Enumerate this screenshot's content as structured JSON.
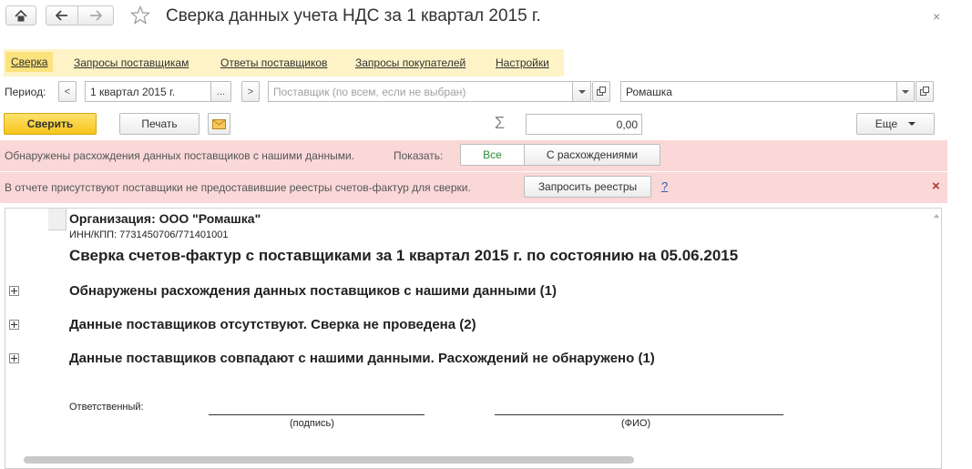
{
  "window": {
    "title": "Сверка данных учета НДС за 1 квартал 2015 г.",
    "close_glyph": "×"
  },
  "nav": {
    "home_icon": "home-icon",
    "back_icon": "arrow-left-icon",
    "forward_icon": "arrow-right-icon",
    "favorite_icon": "star-icon"
  },
  "tabs": [
    {
      "label": "Сверка",
      "active": true
    },
    {
      "label": "Запросы поставщикам"
    },
    {
      "label": "Ответы поставщиков"
    },
    {
      "label": "Запросы покупателей"
    },
    {
      "label": "Настройки"
    }
  ],
  "filters": {
    "period_label": "Период:",
    "period_value": "1 квартал 2015 г.",
    "prev_glyph": "<",
    "next_glyph": ">",
    "dots_glyph": "...",
    "supplier_placeholder": "Поставщик (по всем, если не выбран)",
    "organization_value": "Ромашка"
  },
  "toolbar": {
    "reconcile_label": "Сверить",
    "print_label": "Печать",
    "email_icon": "envelope-icon",
    "sum_glyph": "Σ",
    "sum_value": "0,00",
    "more_label": "Еще"
  },
  "discrepancy_bar": {
    "message": "Обнаружены расхождения данных поставщиков с нашими данными.",
    "show_label": "Показать:",
    "all_label": "Все",
    "with_diff_label": "С расхождениями"
  },
  "missing_bar": {
    "message": "В отчете присутствуют поставщики не предоставившие реестры счетов-фактур для сверки.",
    "request_label": "Запросить реестры",
    "help_glyph": "?",
    "close_glyph": "×"
  },
  "report": {
    "org_line": "Организация: ООО \"Ромашка\"",
    "inn_line": "ИНН/КПП: 7731450706/771401001",
    "heading": "Сверка счетов-фактур с поставщиками за 1 квартал 2015 г. по состоянию на 05.06.2015",
    "groups": [
      "Обнаружены расхождения данных поставщиков с нашими данными (1)",
      "Данные поставщиков отсутствуют. Сверка не проведена (2)",
      "Данные поставщиков совпадают с нашими данными. Расхождений не обнаружено (1)"
    ],
    "responsible_label": "Ответственный:",
    "signature_caption": "(подпись)",
    "name_caption": "(ФИО)"
  },
  "colors": {
    "accent_yellow": "#f6c41c",
    "tab_bar": "#fdf3c6",
    "warning_bg": "#fad8d8",
    "close_red": "#b03a2e",
    "help_blue": "#2a5db0",
    "all_green": "#2e8b3a"
  }
}
